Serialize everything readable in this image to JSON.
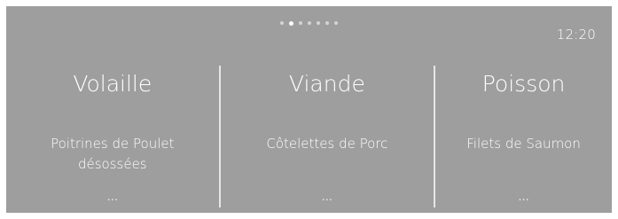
{
  "pager": {
    "count": 7,
    "active_index": 1
  },
  "status": {
    "time": "12:20"
  },
  "categories": [
    {
      "title": "Volaille",
      "item": "Poitrines de Poulet désossées",
      "more": "..."
    },
    {
      "title": "Viande",
      "item": "Côtelettes de Porc",
      "more": "..."
    },
    {
      "title": "Poisson",
      "item": "Filets de Saumon",
      "more": "..."
    }
  ]
}
